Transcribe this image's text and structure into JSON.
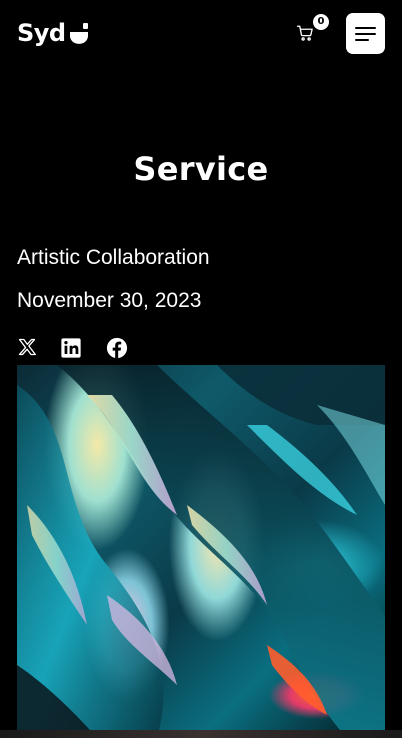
{
  "header": {
    "logo_text": "Syd",
    "cart_count": "0"
  },
  "page": {
    "title": "Service",
    "category": "Artistic Collaboration",
    "date": "November 30, 2023"
  },
  "share": {
    "items": [
      {
        "icon": "x-twitter-icon"
      },
      {
        "icon": "linkedin-icon"
      },
      {
        "icon": "facebook-icon"
      }
    ]
  },
  "hero_image": {
    "subject": "iridescent-liquid-abstract"
  },
  "colors": {
    "background": "#000000",
    "text": "#ffffff",
    "menu_button_bg": "#ffffff"
  }
}
